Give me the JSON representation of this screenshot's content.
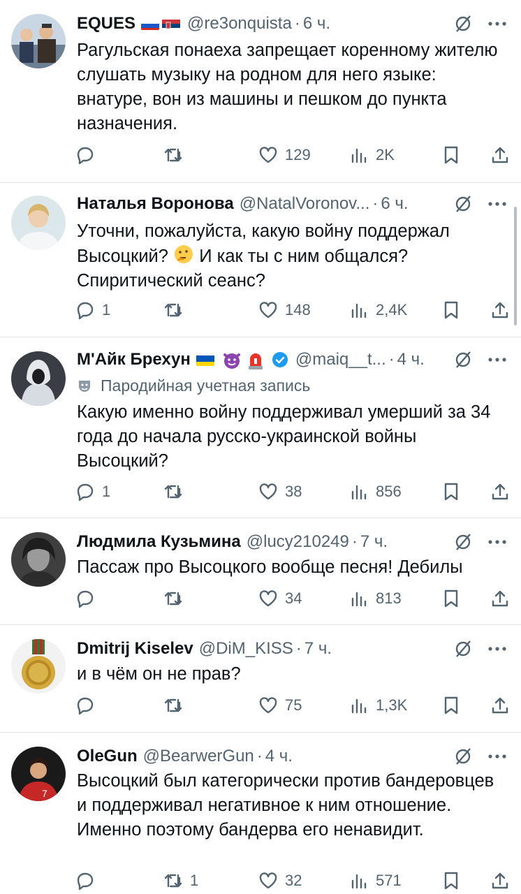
{
  "tweets": [
    {
      "name": "EQUES",
      "handle": "@re3onquista",
      "time": "6 ч.",
      "text": "Рагульская понаеха запрещает коренному жителю слушать музыку на родном для него языке: внатуре, вон из машины и пешком до пункта назначения.",
      "replies": "",
      "reposts": "",
      "likes": "129",
      "views": "2K"
    },
    {
      "name": "Наталья Воронова",
      "handle": "@NatalVoronov...",
      "time": "6 ч.",
      "text_part1": "Уточни, пожалуйста, какую войну поддержал Высоцкий?",
      "text_part2": "И как ты с ним общался? Спиритический сеанс?",
      "replies": "1",
      "reposts": "",
      "likes": "148",
      "views": "2,4K"
    },
    {
      "name": "М'Айк Брехун",
      "handle": "@maiq__t...",
      "time": "4 ч.",
      "parody_label": "Пародийная учетная запись",
      "text": "Какую именно войну поддерживал умерший за 34 года до начала русско-украинской войны Высоцкий?",
      "replies": "1",
      "reposts": "",
      "likes": "38",
      "views": "856"
    },
    {
      "name": "Людмила Кузьмина",
      "handle": "@lucy210249",
      "time": "7 ч.",
      "text": "Пассаж про Высоцкого вообще песня! Дебилы",
      "replies": "",
      "reposts": "",
      "likes": "34",
      "views": "813"
    },
    {
      "name": "Dmitrij Kiselev",
      "handle": "@DiM_KISS",
      "time": "7 ч.",
      "text": "и в чём он не прав?",
      "replies": "",
      "reposts": "",
      "likes": "75",
      "views": "1,3K"
    },
    {
      "name": "OleGun",
      "handle": "@BearwerGun",
      "time": "4 ч.",
      "text": "Высоцкий был категорически против бандеровцев и поддерживал негативное к ним отношение.\nИменно поэтому бандерва его ненавидит.",
      "replies": "",
      "reposts": "1",
      "likes": "32",
      "views": "571"
    }
  ],
  "separator": "·",
  "colors": {
    "text": "#0f1419",
    "secondary": "#536471",
    "divider": "#dfe3e6",
    "verified": "#1d9bf0"
  }
}
